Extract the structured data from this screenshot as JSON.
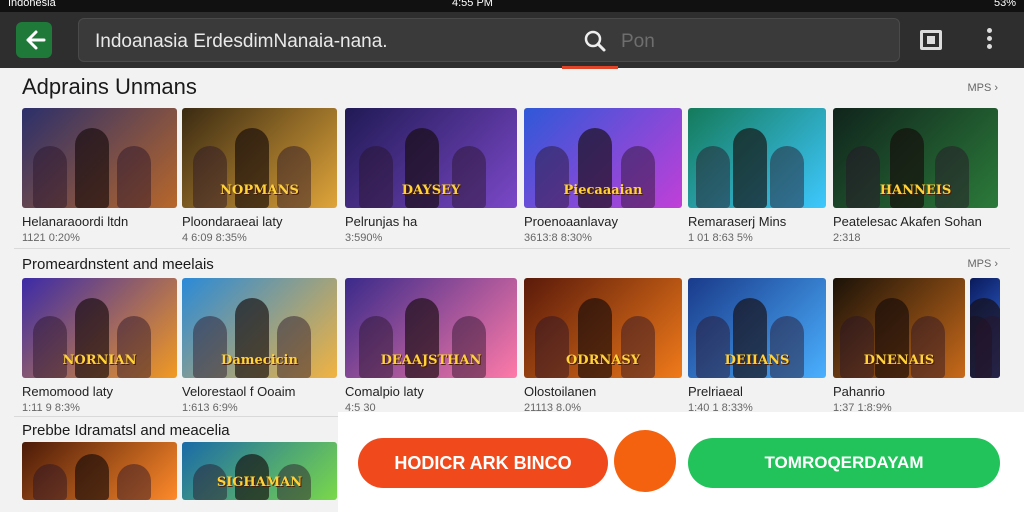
{
  "status_bar": {
    "left": "Indonesia",
    "time": "4:55 PM",
    "battery": "53%"
  },
  "header": {
    "search_query": "Indoanasia ErdesdimNanaia-nana.",
    "search_hint": "Pon"
  },
  "sections": [
    {
      "title": "Adprains Unmans",
      "see_more": "MPS ›",
      "items": [
        {
          "name": "Helanaraoordi ltdn",
          "meta": "1121 0:20%",
          "banner": ""
        },
        {
          "name": "Ploondaraeai laty",
          "meta": "4 6:09 8:35%",
          "banner": "NOPMANS"
        },
        {
          "name": "Pelrunjas ha",
          "meta": "3:590%",
          "banner": "DAYSEY"
        },
        {
          "name": "Proenoaanlavay",
          "meta": "3613:8 8:30%",
          "banner": "Piecaaaian"
        },
        {
          "name": "Remaraserj Mins",
          "meta": "1 01 8:63 5%",
          "banner": ""
        },
        {
          "name": "Peatelesac Akafen Sohan",
          "meta": "2:318",
          "banner": "HANNEIS"
        }
      ]
    },
    {
      "title": "Promeardnstent and meelais",
      "see_more": "MPS ›",
      "items": [
        {
          "name": "Remomood laty",
          "meta": "1:11 9 8:3%",
          "banner": "NORNIAN"
        },
        {
          "name": "Velorestaol f Ooaim",
          "meta": "1:613 6:9%",
          "banner": "Damecicin"
        },
        {
          "name": "Comalpio laty",
          "meta": "4:5 30",
          "banner": "DEAAJSTHAN"
        },
        {
          "name": "Olostoilanen",
          "meta": "21113 8.0%",
          "banner": "ODRNASY"
        },
        {
          "name": "Prelriaeal",
          "meta": "1:40 1 8:33%",
          "banner": "DEIIANS"
        },
        {
          "name": "Pahanrio",
          "meta": "1:37 1:8:9%",
          "banner": "DNENAIS"
        },
        {
          "name": "",
          "meta": "",
          "banner": ""
        }
      ]
    },
    {
      "title": "Prebbe Idramatsl and meacelia",
      "items": [
        {
          "name": "",
          "meta": "",
          "banner": ""
        },
        {
          "name": "",
          "meta": "",
          "banner": "SIGHAMAN"
        }
      ]
    }
  ],
  "cta": {
    "primary_label": "HODICR ARK BINCO",
    "secondary_label": "TOMROQERDAYAM"
  },
  "colors": {
    "appbar": "#2e2e2e",
    "primary_button": "#f04a1c",
    "secondary_button": "#22c35a",
    "accent": "#e0452a"
  },
  "icons": {
    "back": "back-arrow-icon",
    "search": "search-icon",
    "cast": "cast-icon",
    "menu": "more-vert-icon"
  }
}
